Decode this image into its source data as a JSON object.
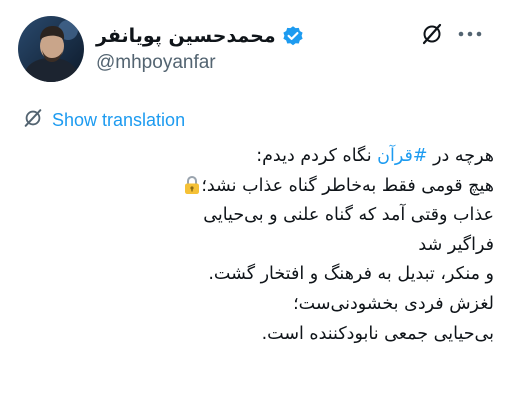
{
  "author": {
    "display_name": "محمدحسین پویانفر",
    "handle": "@mhpoyanfar",
    "verified": true,
    "avatar_icon": "avatar-photo"
  },
  "header_icons": {
    "grok": "grok-icon",
    "more": "more-icon"
  },
  "translation": {
    "label": "Show translation",
    "icon": "grok-icon"
  },
  "tweet": {
    "line1_before": "هرچه در ",
    "hashtag": "#قرآن",
    "line1_after": " نگاه کردم دیدم:",
    "line2": "هیچ قومی فقط به‌خاطر گناه عذاب نشد؛",
    "line2_emoji": "lock-icon",
    "line3": "عذاب وقتی آمد که گناه علنی و بی‌حیایی",
    "line4": "فراگیر شد",
    "line5": "و منکر، تبدیل به فرهنگ و افتخار گشت.",
    "line6": "لغزش فردی بخشودنی‌ست؛",
    "line7": "بی‌حیایی جمعی نابودکننده است."
  },
  "colors": {
    "accent": "#1d9bf0",
    "text": "#0f1419",
    "secondary": "#536471"
  }
}
